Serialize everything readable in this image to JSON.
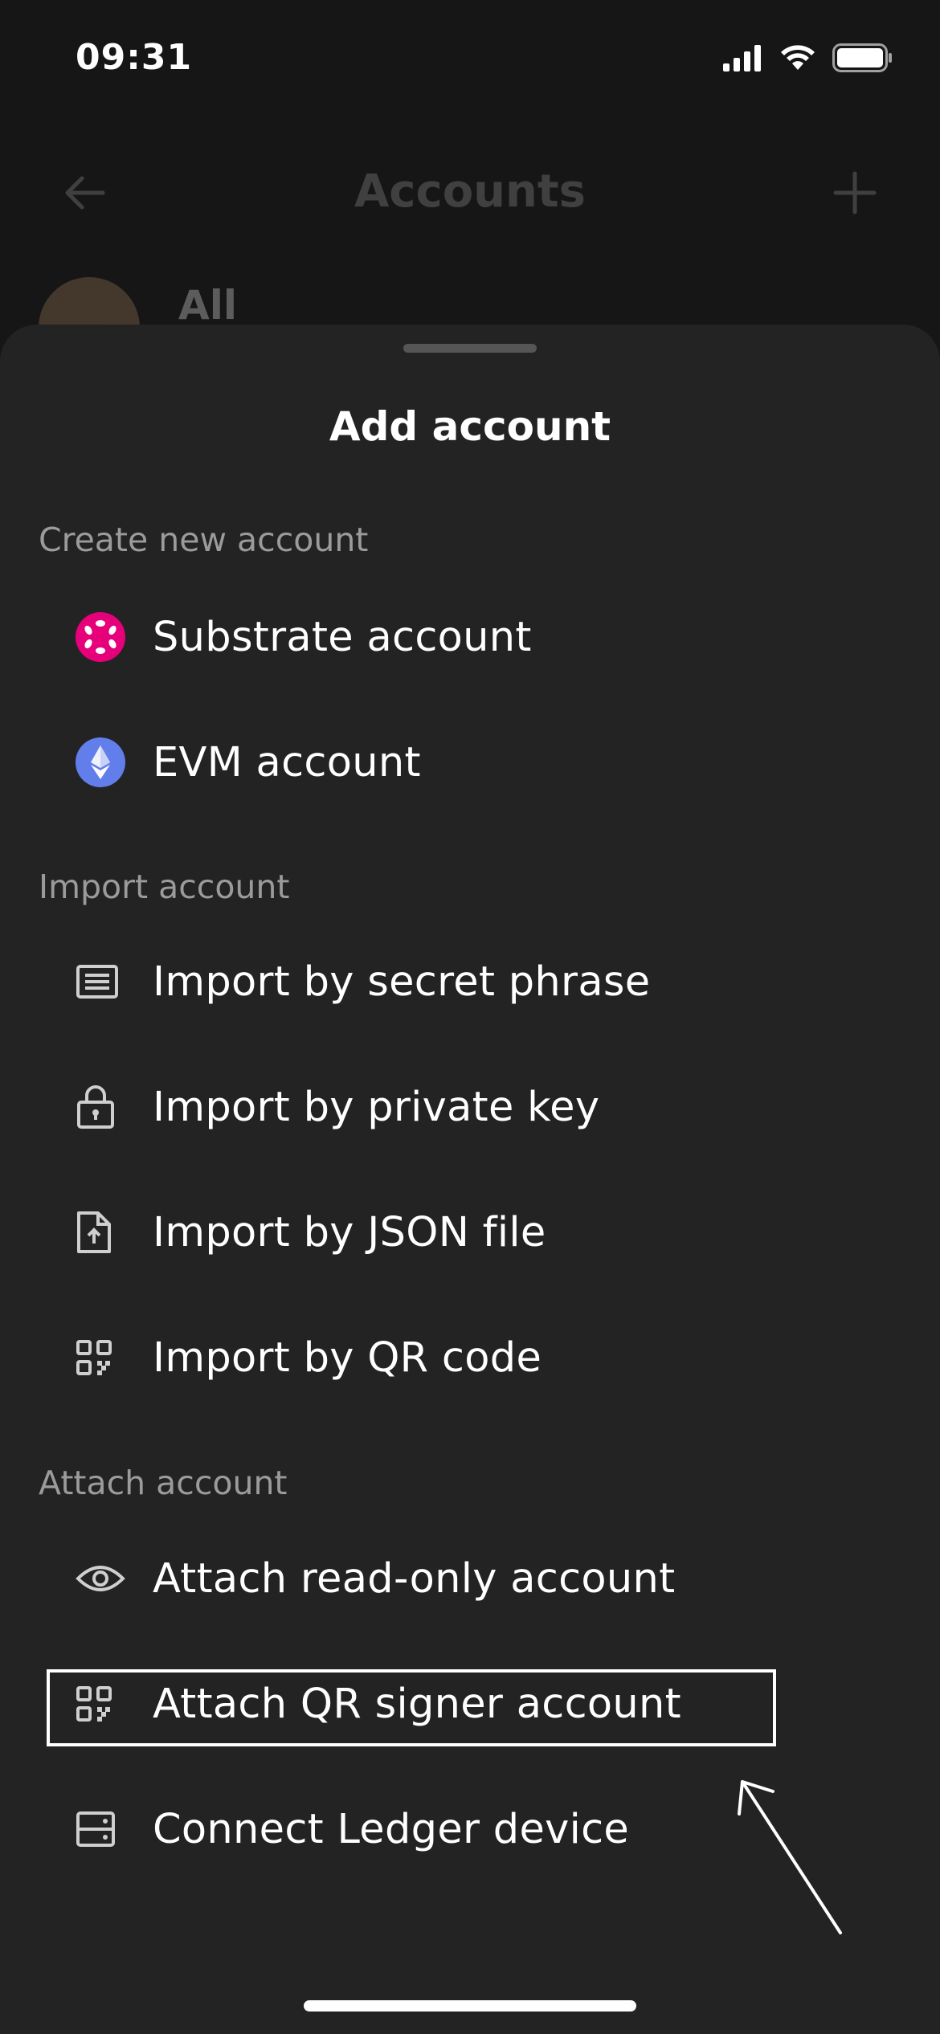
{
  "status_bar": {
    "time": "09:31"
  },
  "background": {
    "title": "Accounts",
    "row_label": "All"
  },
  "sheet": {
    "title": "Add account",
    "sections": {
      "create": {
        "label": "Create new account",
        "items": {
          "substrate": {
            "label": "Substrate account",
            "icon": "polkadot-icon"
          },
          "evm": {
            "label": "EVM account",
            "icon": "ethereum-icon"
          }
        }
      },
      "import": {
        "label": "Import account",
        "items": {
          "secret_phrase": {
            "label": "Import by secret phrase",
            "icon": "document-lines-icon"
          },
          "private_key": {
            "label": "Import by private key",
            "icon": "lock-icon"
          },
          "json_file": {
            "label": "Import by JSON file",
            "icon": "file-upload-icon"
          },
          "qr_code": {
            "label": "Import by QR code",
            "icon": "qr-icon"
          }
        }
      },
      "attach": {
        "label": "Attach account",
        "items": {
          "read_only": {
            "label": "Attach read-only account",
            "icon": "eye-icon"
          },
          "qr_signer": {
            "label": "Attach QR signer account",
            "icon": "qr-icon"
          },
          "ledger": {
            "label": "Connect Ledger device",
            "icon": "ledger-icon"
          }
        }
      }
    }
  },
  "colors": {
    "sheet_bg": "#232323",
    "section_text": "#9b9b9b",
    "polkadot": "#e6007a",
    "ethereum": "#627eea"
  }
}
